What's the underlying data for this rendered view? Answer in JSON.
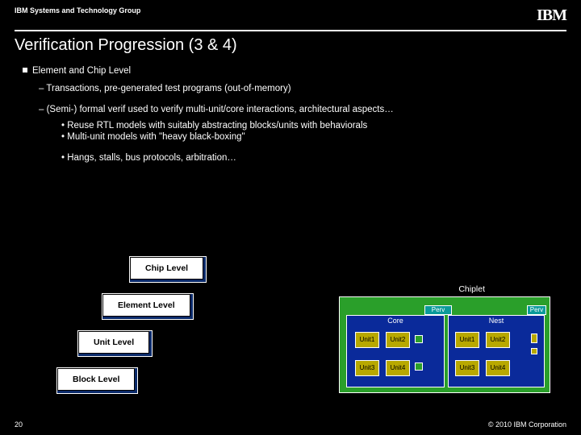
{
  "header": {
    "group": "IBM Systems and Technology Group",
    "logo": "IBM"
  },
  "title": "Verification Progression (3 & 4)",
  "bullets": {
    "l1": "Element and Chip Level",
    "l2a": "Transactions, pre-generated test programs (out-of-memory)",
    "l2b": "(Semi-) formal verif used to verify multi-unit/core interactions, architectural aspects…",
    "l3a": "Reuse RTL models with suitably abstracting blocks/units with behaviorals",
    "l3b": "Multi-unit models with \"heavy black-boxing\"",
    "l3c": "Hangs, stalls, bus protocols, arbitration…"
  },
  "stair": {
    "b1": "Chip Level",
    "b2": "Element Level",
    "b3": "Unit Level",
    "b4": "Block Level"
  },
  "diagram": {
    "chiplet": "Chiplet",
    "core": "Core",
    "nest": "Nest",
    "perv": "Perv",
    "unit1": "Unit1",
    "unit2": "Unit2",
    "unit3": "Unit3",
    "unit4": "Unit4"
  },
  "footer": {
    "page": "20",
    "copyright": "© 2010 IBM Corporation"
  }
}
